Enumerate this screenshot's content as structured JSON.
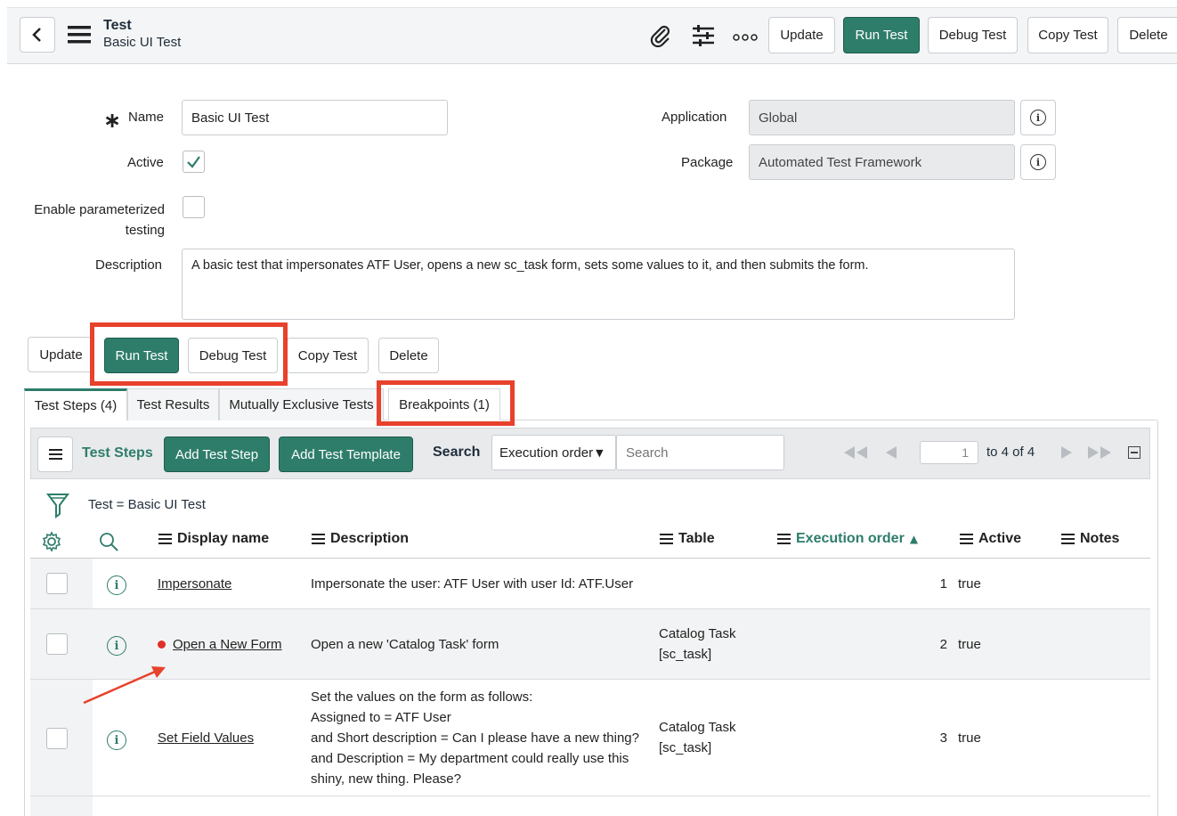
{
  "header": {
    "title": "Test",
    "subtitle": "Basic UI Test",
    "buttons": {
      "update": "Update",
      "run": "Run Test",
      "debug": "Debug Test",
      "copy": "Copy Test",
      "delete": "Delete"
    },
    "icons": [
      "back-icon",
      "menu-icon",
      "attachment-icon",
      "settings-sliders-icon",
      "more-options-icon"
    ]
  },
  "form": {
    "name_label": "Name",
    "name_value": "Basic UI Test",
    "active_label": "Active",
    "active_checked": true,
    "param_label_line1": "Enable parameterized",
    "param_label_line2": "testing",
    "param_checked": false,
    "description_label": "Description",
    "description_value": "A basic test that impersonates ATF User, opens a new sc_task form, sets some values to it, and then submits the form.",
    "application_label": "Application",
    "application_value": "Global",
    "package_label": "Package",
    "package_value": "Automated Test Framework"
  },
  "actions": {
    "update": "Update",
    "run": "Run Test",
    "debug": "Debug Test",
    "copy": "Copy Test",
    "delete": "Delete"
  },
  "tabs": [
    {
      "label": "Test Steps (4)",
      "active": true
    },
    {
      "label": "Test Results",
      "active": false
    },
    {
      "label": "Mutually Exclusive Tests",
      "active": false
    },
    {
      "label": "Breakpoints (1)",
      "active": false
    }
  ],
  "list": {
    "title": "Test Steps",
    "add_step": "Add Test Step",
    "add_template": "Add Test Template",
    "search_label": "Search",
    "search_field": "Execution order",
    "search_placeholder": "Search",
    "page_value": "1",
    "page_range": "to 4 of 4",
    "filter_text": "Test = Basic UI Test",
    "columns": {
      "display_name": "Display name",
      "description": "Description",
      "table": "Table",
      "execution_order": "Execution order",
      "active": "Active",
      "notes": "Notes"
    },
    "rows": [
      {
        "name": "Impersonate",
        "description": [
          "Impersonate the user: ATF User with user Id: ATF.User"
        ],
        "table": [],
        "order": "1",
        "active": "true",
        "breakpoint": false
      },
      {
        "name": "Open a New Form",
        "description": [
          "Open a new 'Catalog Task' form"
        ],
        "table": [
          "Catalog Task",
          "[sc_task]"
        ],
        "order": "2",
        "active": "true",
        "breakpoint": true
      },
      {
        "name": "Set Field Values",
        "description": [
          "Set the values on the form as follows:",
          "Assigned to = ATF User",
          "and Short description = Can I please have a new thing?",
          "and Description = My department could really use this",
          "shiny, new thing. Please?"
        ],
        "table": [
          "Catalog Task",
          "[sc_task]"
        ],
        "order": "3",
        "active": "true",
        "breakpoint": false
      }
    ]
  },
  "colors": {
    "accent": "#2e7d6b",
    "highlight": "#e8412c",
    "breakpoint": "#e0302a"
  }
}
